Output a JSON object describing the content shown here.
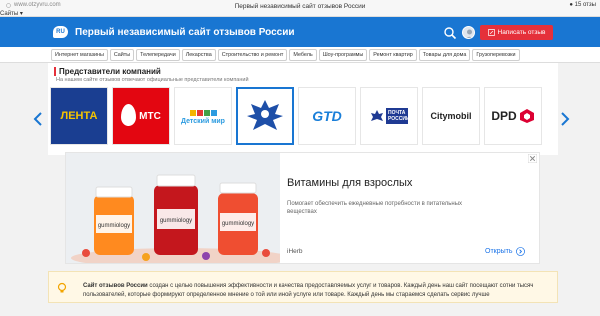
{
  "browser": {
    "url": "www.otzyvru.com",
    "tab_title": "Первый независимый сайт отзывов России",
    "sites_label": "Сайты",
    "right_status": "15 отзы"
  },
  "header": {
    "logo_text": "RU",
    "site_title": "Первый независимый сайт отзывов России",
    "write_review_label": "Написать отзыв"
  },
  "nav": {
    "items": [
      "Интернет магазины",
      "Сайты",
      "Телепередачи",
      "Лекарства",
      "Строительство и ремонт",
      "Мебель",
      "Шоу-программы",
      "Ремонт квартир",
      "Товары для дома",
      "Грузоперевозки"
    ]
  },
  "representatives": {
    "title": "Представители компаний",
    "subtitle": "На нашем сайте отзывов отвечают официальные представители компаний",
    "logos": [
      {
        "name": "lenta",
        "text": "ЛЕНТА",
        "color": "#1a3e91",
        "accent": "#f5c400"
      },
      {
        "name": "mts",
        "text": "МТС",
        "color": "#e30611"
      },
      {
        "name": "detsky-mir",
        "text": "Детский мир",
        "color": "#2c9be0"
      },
      {
        "name": "russian-eagle",
        "text": "",
        "color": "#1e4fa8"
      },
      {
        "name": "gtd",
        "text": "GTD",
        "color": "#1a7fd9"
      },
      {
        "name": "pochta",
        "text": "ПОЧТА РОССИИ",
        "color": "#1f3a93"
      },
      {
        "name": "citymobil",
        "text": "Citymobil",
        "color": "#222222"
      },
      {
        "name": "dpd",
        "text": "DPD",
        "color": "#dc0032"
      }
    ]
  },
  "ad": {
    "headline": "Витамины для взрослых",
    "description": "Помогает обеспечить ежедневные потребности в питательных веществах",
    "brand": "iHerb",
    "open_label": "Открыть",
    "product_label": "gummiology",
    "product_colors": [
      "#ff8a1f",
      "#c4171d",
      "#ef4e31"
    ]
  },
  "about": {
    "bold": "Сайт отзывов России",
    "text": " создан с целью повышения эффективности и качества предоставляемых услуг и товаров. Каждый день наш сайт посещают сотни тысяч пользователей, которые формируют определенное мнение о той или иной услуге или товаре. Каждый день мы стараемся сделать сервис лучше"
  }
}
